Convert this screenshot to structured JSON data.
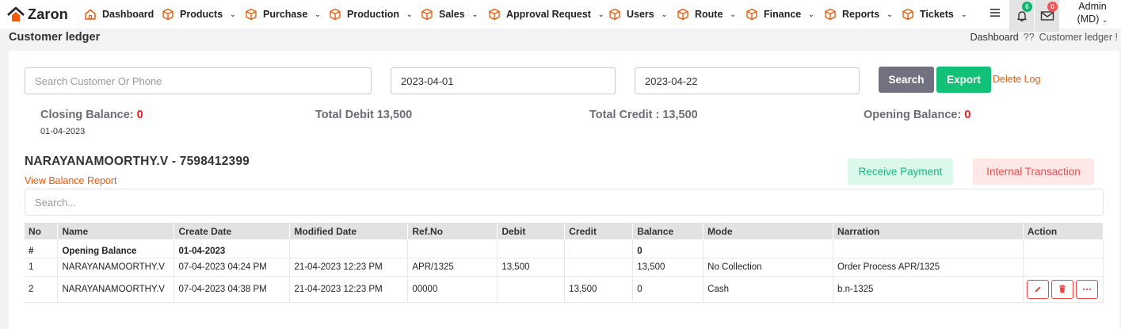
{
  "app": {
    "name": "Zaron"
  },
  "nav": {
    "items": [
      {
        "label": "Dashboard",
        "chevron": false
      },
      {
        "label": "Products",
        "chevron": true
      },
      {
        "label": "Purchase",
        "chevron": true
      },
      {
        "label": "Production",
        "chevron": true
      },
      {
        "label": "Sales",
        "chevron": true
      },
      {
        "label": "Approval Request",
        "chevron": true
      },
      {
        "label": "Users",
        "chevron": true
      },
      {
        "label": "Route",
        "chevron": true
      },
      {
        "label": "Finance",
        "chevron": true
      },
      {
        "label": "Reports",
        "chevron": true
      },
      {
        "label": "Tickets",
        "chevron": true
      }
    ],
    "notification_count": "6",
    "message_count": "0",
    "user_line1": "Admin",
    "user_line2": "(MD)"
  },
  "page": {
    "title": "Customer ledger",
    "breadcrumb_home": "Dashboard",
    "breadcrumb_sep": "??",
    "breadcrumb_current": "Customer ledger !"
  },
  "filters": {
    "search_placeholder": "Search Customer Or Phone",
    "search_value": "",
    "from_date": "2023-04-01",
    "to_date": "2023-04-22",
    "search_label": "Search",
    "export_label": "Export",
    "delete_log_label": "Delete Log"
  },
  "summary": {
    "closing_label": "Closing Balance:",
    "closing_value": "0",
    "closing_date": "01-04-2023",
    "total_debit": "Total Debit 13,500",
    "total_credit": "Total Credit : 13,500",
    "opening_label": "Opening Balance:",
    "opening_value": "0"
  },
  "customer": {
    "title": "NARAYANAMOORTHY.V - 7598412399",
    "view_balance_label": "View Balance Report",
    "receive_payment_label": "Receive Payment",
    "internal_transaction_label": "Internal Transaction",
    "table_search_placeholder": "Search..."
  },
  "table": {
    "columns": [
      "No",
      "Name",
      "Create Date",
      "Modified Date",
      "Ref.No",
      "Debit",
      "Credit",
      "Balance",
      "Mode",
      "Narration",
      "Action"
    ],
    "rows": [
      {
        "no": "#",
        "name": "Opening Balance",
        "create": "01-04-2023",
        "modified": "",
        "ref": "",
        "debit": "",
        "credit": "",
        "balance": "0",
        "balance_color": "#0e9e34",
        "mode": "",
        "narration": ""
      },
      {
        "no": "1",
        "name": "NARAYANAMOORTHY.V",
        "create": "07-04-2023 04:24 PM",
        "modified": "21-04-2023 12:23 PM",
        "ref": "APR/1325",
        "debit": "13,500",
        "credit": "",
        "balance": "13,500",
        "balance_color": "#f01c1c",
        "mode": "No Collection",
        "narration": "Order Process APR/1325"
      },
      {
        "no": "2",
        "name": "NARAYANAMOORTHY.V",
        "create": "07-04-2023 04:38 PM",
        "modified": "21-04-2023 12:23 PM",
        "ref": "00000",
        "debit": "",
        "credit": "13,500",
        "balance": "0",
        "balance_color": "#0e9e34",
        "mode": "Cash",
        "narration": "b.n-1325"
      }
    ]
  },
  "colors": {
    "accent_orange": "#f05a0a",
    "search_button": "#71717f",
    "export_button": "#12c177",
    "receive_bg": "#dcf7ec",
    "receive_text": "#18b880",
    "internal_bg": "#fde7e7",
    "internal_text": "#ef4d4d"
  }
}
